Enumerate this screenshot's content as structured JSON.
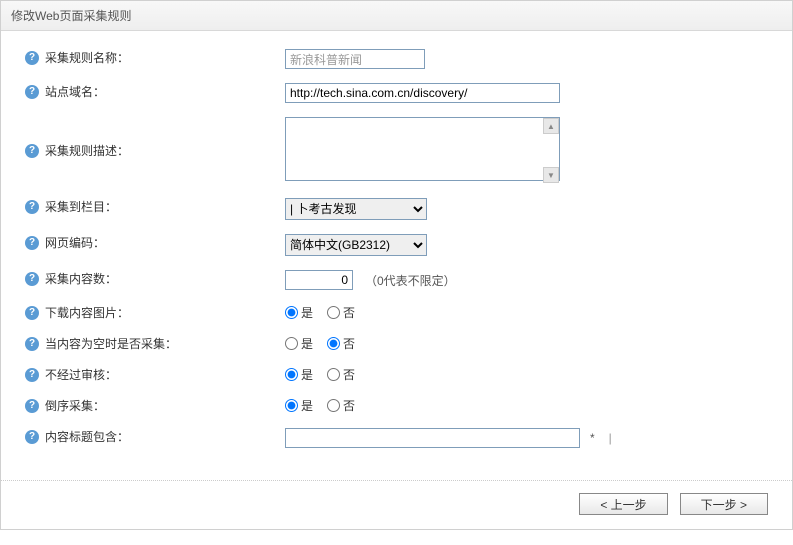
{
  "header": {
    "title": "修改Web页面采集规则"
  },
  "labels": {
    "ruleName": "采集规则名称：",
    "siteDomain": "站点域名：",
    "ruleDesc": "采集规则描述：",
    "collectTo": "采集到栏目：",
    "encoding": "网页编码：",
    "collectCount": "采集内容数：",
    "downloadImg": "下载内容图片：",
    "emptyContent": "当内容为空时是否采集：",
    "noAudit": "不经过审核：",
    "reverseCollect": "倒序采集：",
    "titleContains": "内容标题包含："
  },
  "fields": {
    "ruleName": "新浪科普新闻",
    "siteDomain": "http://tech.sina.com.cn/discovery/",
    "ruleDesc": "",
    "collectToSelected": "  | 卜考古发现",
    "encodingSelected": "简体中文(GB2312)",
    "collectCount": "0",
    "collectCountHint": "（0代表不限定）",
    "titleContains": ""
  },
  "radios": {
    "yes": "是",
    "no": "否",
    "downloadImg": "yes",
    "emptyContent": "no",
    "noAudit": "yes",
    "reverseCollect": "yes"
  },
  "buttons": {
    "prev": "< 上一步",
    "next": "下一步 >"
  },
  "marks": {
    "star": "*",
    "pipe": "|"
  }
}
